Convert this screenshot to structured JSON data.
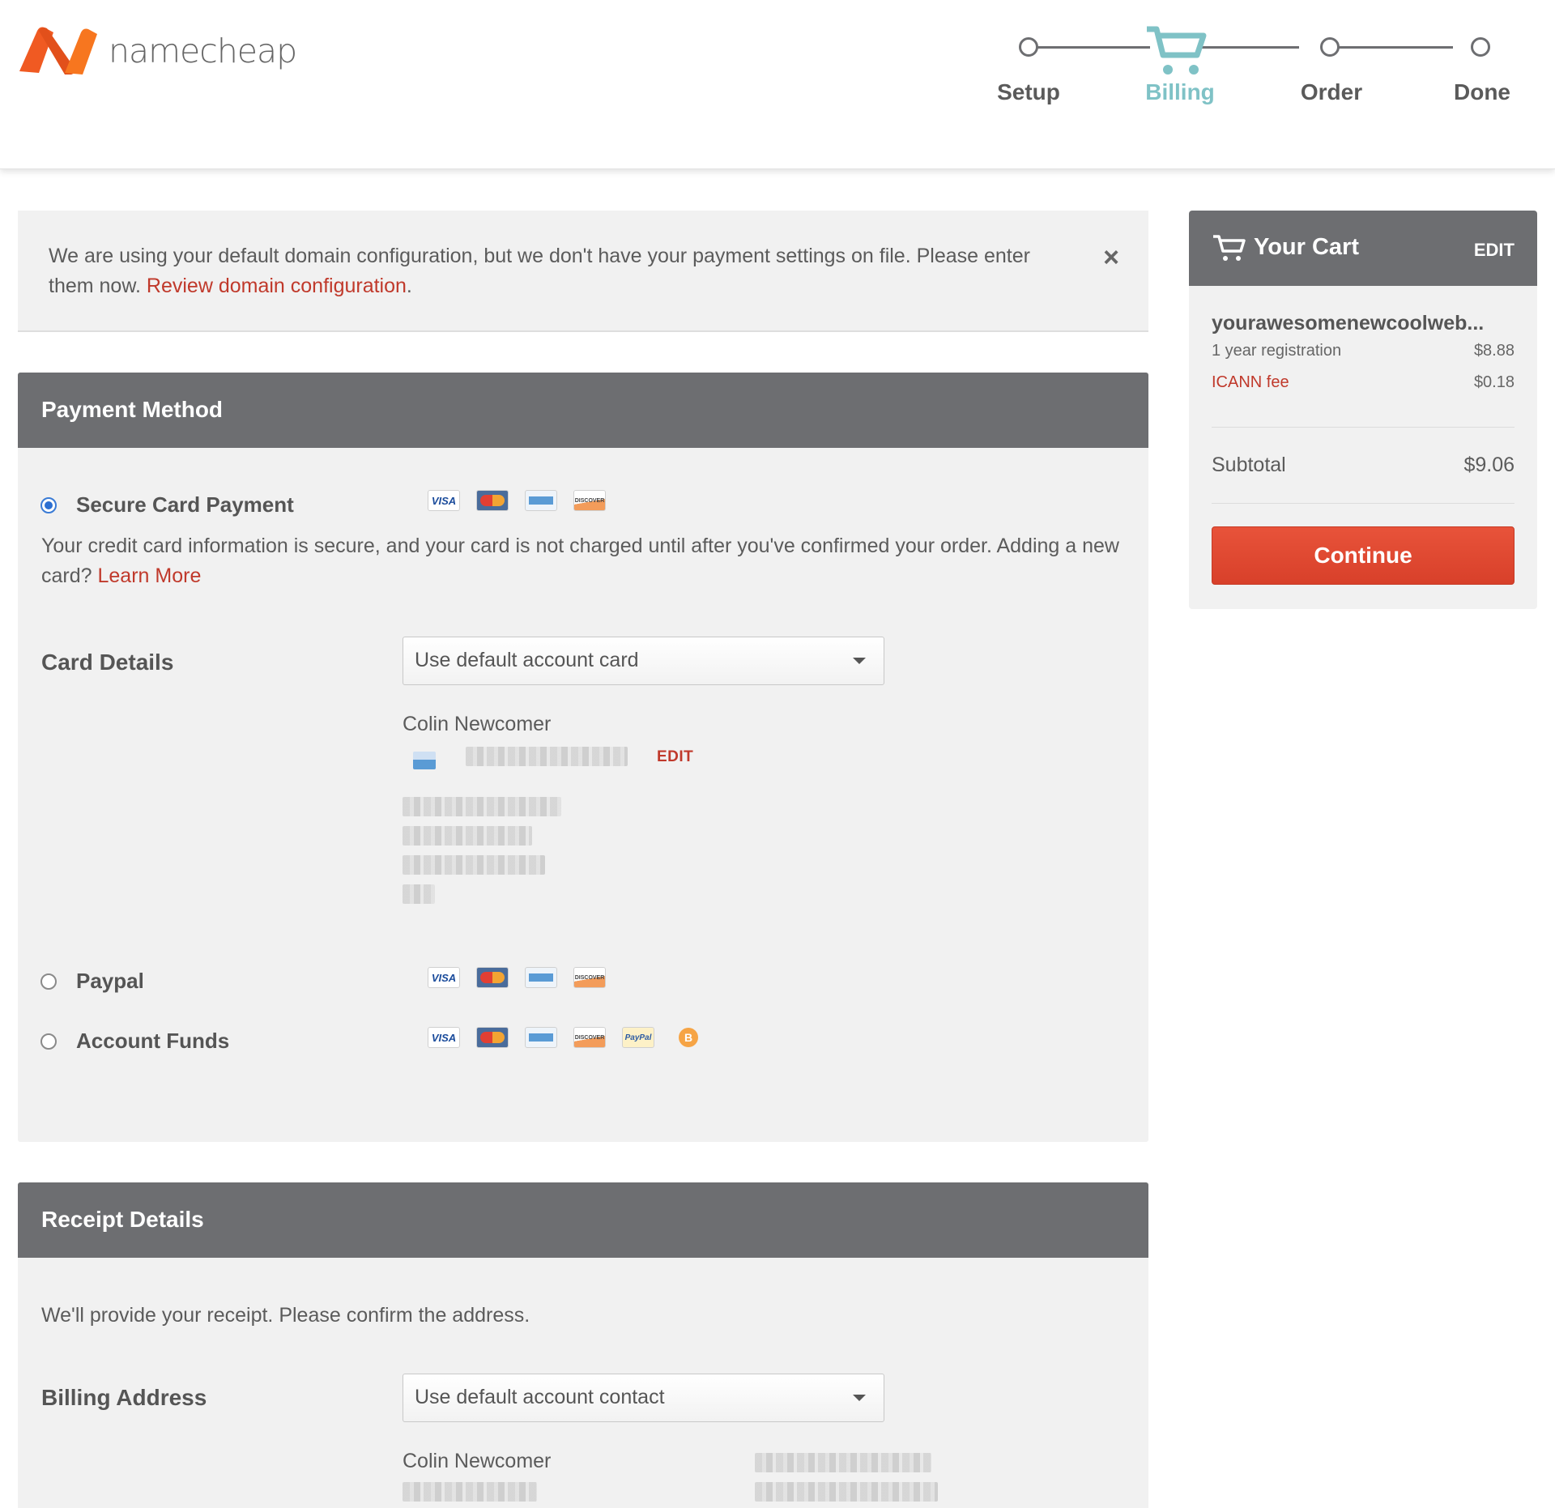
{
  "header": {
    "logo_text": "namecheap",
    "steps": [
      {
        "label": "Setup",
        "state": "done"
      },
      {
        "label": "Billing",
        "state": "active"
      },
      {
        "label": "Order",
        "state": "pending"
      },
      {
        "label": "Done",
        "state": "pending"
      }
    ],
    "active_color": "#7fc2c6"
  },
  "notice": {
    "text": "We are using your default domain configuration, but we don't have your payment settings on file. Please enter them now.",
    "link": "Review domain configuration",
    "link_suffix": ".",
    "close_icon": "×"
  },
  "payment": {
    "title": "Payment Method",
    "options": [
      {
        "label": "Secure Card Payment",
        "selected": true,
        "icons": [
          "visa-icon",
          "mastercard-icon",
          "amex-icon",
          "discover-icon"
        ]
      },
      {
        "label": "Paypal",
        "selected": false,
        "icons": [
          "visa-icon",
          "mastercard-icon",
          "amex-icon",
          "discover-icon"
        ]
      },
      {
        "label": "Account Funds",
        "selected": false,
        "icons": [
          "visa-icon",
          "mastercard-icon",
          "amex-icon",
          "discover-icon",
          "paypal-icon",
          "bitcoin-icon"
        ]
      }
    ],
    "secure_text": "Your credit card information is secure, and your card is not charged until after you've confirmed your order. Adding a new card?",
    "learn_more": "Learn More",
    "card_details_label": "Card Details",
    "card_select": "Use default account card",
    "card_holder": "Colin Newcomer",
    "edit_label": "EDIT"
  },
  "receipt": {
    "title": "Receipt Details",
    "text": "We'll provide your receipt. Please confirm the address.",
    "billing_label": "Billing Address",
    "billing_select": "Use default account contact",
    "contact_name": "Colin Newcomer"
  },
  "cart": {
    "title": "Your Cart",
    "edit_label": "EDIT",
    "domain": "yourawesomenewcoolweb...",
    "lines": [
      {
        "label": "1 year registration",
        "price": "$8.88",
        "highlight": false
      },
      {
        "label": "ICANN fee",
        "price": "$0.18",
        "highlight": true
      }
    ],
    "subtotal_label": "Subtotal",
    "subtotal_value": "$9.06",
    "continue_label": "Continue",
    "button_color": "#e14a33"
  },
  "card_icon_labels": {
    "visa": "VISA",
    "discover": "DISCOVER",
    "paypal": "PayPal",
    "bitcoin": "B"
  }
}
